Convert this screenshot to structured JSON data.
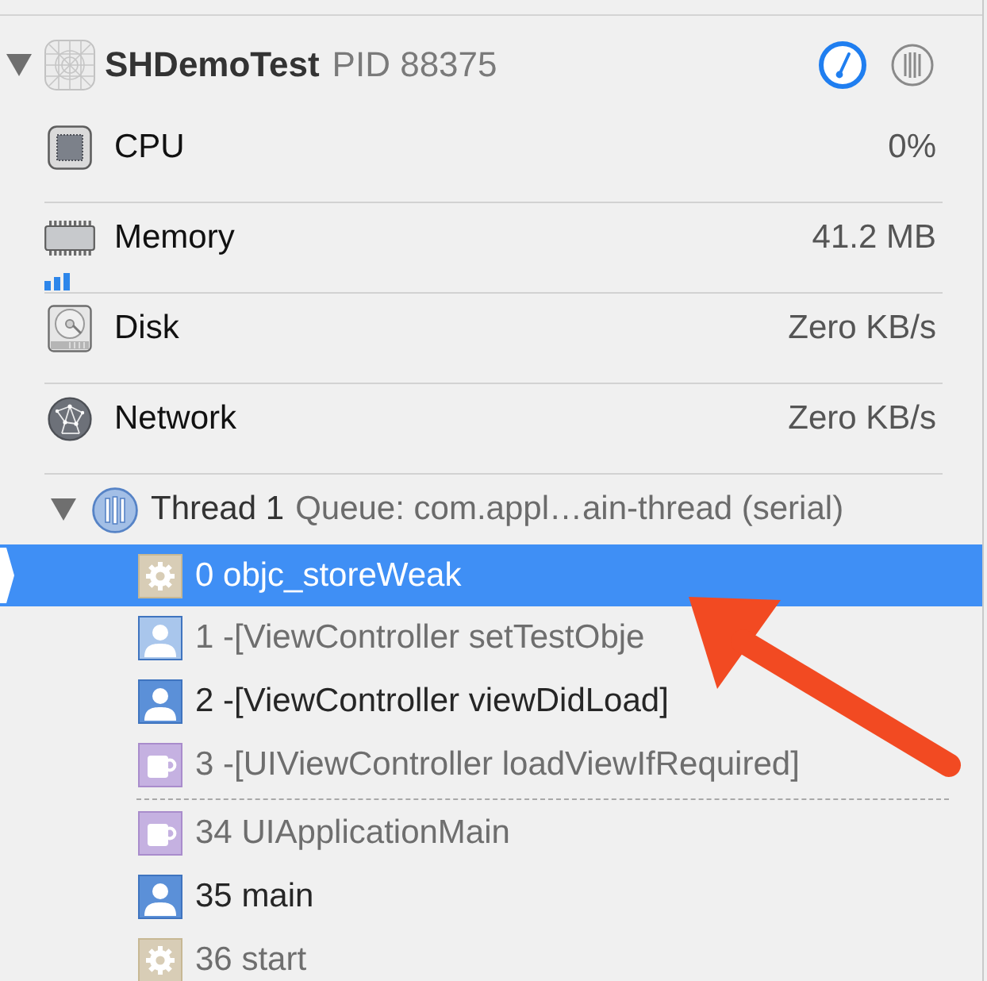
{
  "process": {
    "name": "SHDemoTest",
    "pid": "PID 88375",
    "expanded": true,
    "buttons": [
      {
        "kind": "gauges",
        "selected": true
      },
      {
        "kind": "threads",
        "selected": false
      }
    ]
  },
  "gauges": [
    {
      "kind": "cpu",
      "label": "CPU",
      "reading": "0%"
    },
    {
      "kind": "memory",
      "label": "Memory",
      "reading": "41.2 MB"
    },
    {
      "kind": "disk",
      "label": "Disk",
      "reading": "Zero KB/s"
    },
    {
      "kind": "network",
      "label": "Network",
      "reading": "Zero KB/s"
    }
  ],
  "thread": {
    "label": "Thread 1",
    "queue": "Queue: com.appl…ain-thread (serial)",
    "expanded": true,
    "frames": [
      {
        "kind": "system",
        "label": "0 objc_storeWeak",
        "selected": true,
        "dimmed": true,
        "gap_before": false
      },
      {
        "kind": "user",
        "label": "1 -[ViewController setTestObje",
        "selected": false,
        "dimmed": true,
        "gap_before": false
      },
      {
        "kind": "user",
        "label": "2 -[ViewController viewDidLoad]",
        "selected": false,
        "dimmed": false,
        "gap_before": false
      },
      {
        "kind": "framework",
        "label": "3 -[UIViewController loadViewIfRequired]",
        "selected": false,
        "dimmed": true,
        "gap_before": false
      },
      {
        "kind": "framework",
        "label": "34 UIApplicationMain",
        "selected": false,
        "dimmed": true,
        "gap_before": true
      },
      {
        "kind": "user",
        "label": "35 main",
        "selected": false,
        "dimmed": false,
        "gap_before": false
      },
      {
        "kind": "system",
        "label": "36 start",
        "selected": false,
        "dimmed": true,
        "gap_before": false
      }
    ]
  }
}
